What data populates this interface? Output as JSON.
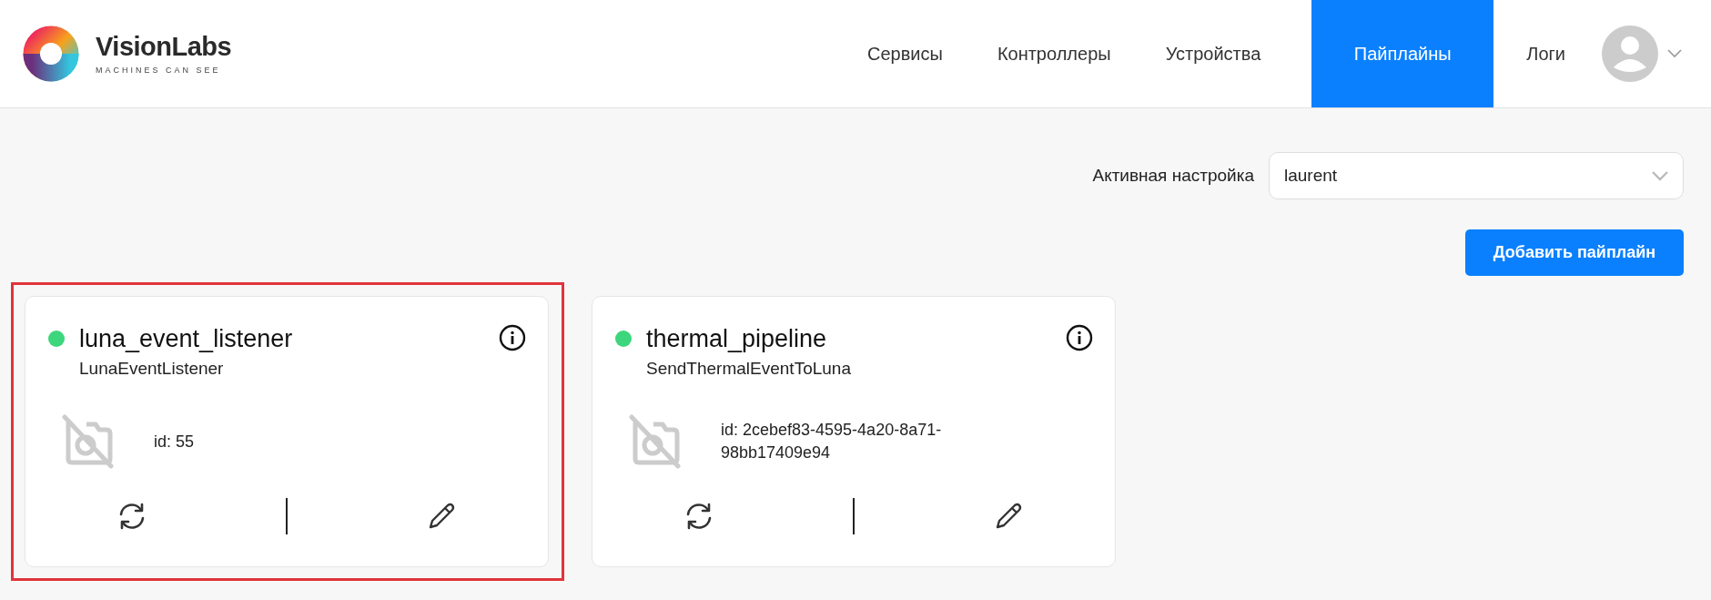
{
  "logo": {
    "name": "VisionLabs",
    "tagline": "MACHINES CAN SEE"
  },
  "nav": [
    {
      "label": "Сервисы",
      "selected": false
    },
    {
      "label": "Контроллеры",
      "selected": false
    },
    {
      "label": "Устройства",
      "selected": false
    },
    {
      "label": "Пайплайны",
      "selected": true
    },
    {
      "label": "Логи",
      "selected": false
    }
  ],
  "active_setting": {
    "label": "Активная настройка",
    "value": "laurent"
  },
  "add_button": "Добавить пайплайн",
  "pipelines": [
    {
      "name": "luna_event_listener",
      "type": "LunaEventListener",
      "id": "id: 55",
      "color": "#3dd67c",
      "highlighted": true
    },
    {
      "name": "thermal_pipeline",
      "type": "SendThermalEventToLuna",
      "id": "id: 2cebef83-4595-4a20-8a71-98bb17409e94",
      "color": "#3dd67c",
      "highlighted": false
    }
  ]
}
